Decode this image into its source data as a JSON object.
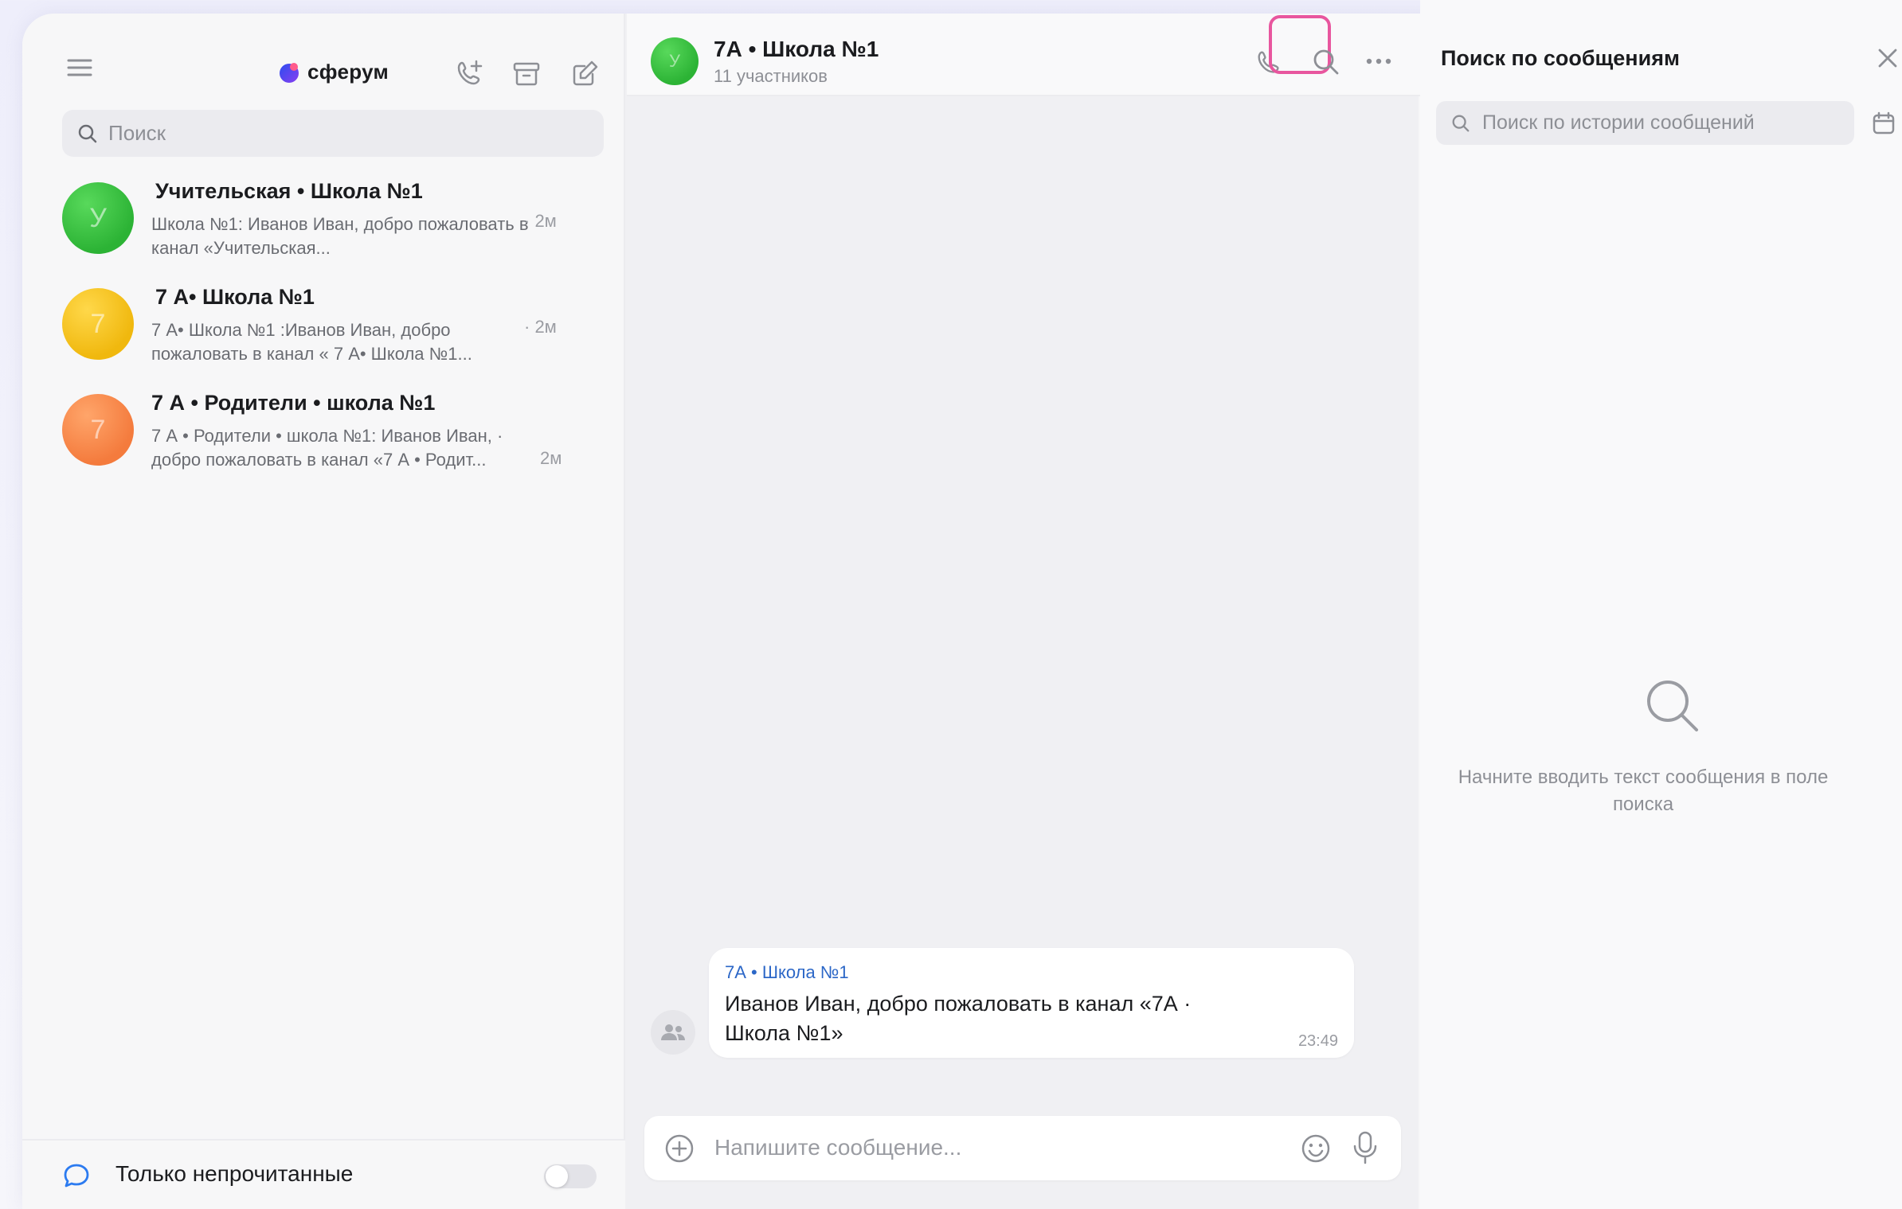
{
  "app": {
    "logo_text": "сферум",
    "brand_colors": {
      "logo_blue": "#2b4df0",
      "logo_purple": "#8a3ff0",
      "highlight": "#e8569e",
      "link": "#2c67c7"
    }
  },
  "sidebar": {
    "search_placeholder": "Поиск",
    "toolbar_icons": [
      "menu-icon",
      "call-add-icon",
      "archive-icon",
      "compose-icon"
    ],
    "chats": [
      {
        "title": "Учительская • Школа №1",
        "preview": "Школа №1: Иванов Иван, добро пожаловать в канал «Учительская...",
        "time": "· 2м",
        "avatar_letter": "У",
        "avatar_color": "#2cb335"
      },
      {
        "title": "7 А• Школа №1",
        "preview": "7 А• Школа №1 :Иванов Иван, добро пожаловать в канал « 7 А• Школа №1...",
        "time": "· 2м",
        "avatar_letter": "7",
        "avatar_color": "#f0b80e"
      },
      {
        "title": "7 А • Родители • школа №1",
        "preview": "7 А • Родители • школа №1: Иванов Иван, · добро пожаловать в канал «7 А • Родит...",
        "time": "2м",
        "avatar_letter": "7",
        "avatar_color": "#f47b3d"
      }
    ],
    "unread_only_label": "Только непрочитанные",
    "unread_only_enabled": false
  },
  "chat": {
    "title": "7А • Школа №1",
    "subtitle": "11 участников",
    "avatar_letter": "У",
    "message": {
      "from": "7А • Школа №1",
      "text": "Иванов Иван, добро пожаловать в канал «7А · Школа №1»",
      "time": "23:49"
    },
    "composer_placeholder": "Напишите сообщение..."
  },
  "search_panel": {
    "title": "Поиск по сообщениям",
    "placeholder": "Поиск по истории сообщений",
    "empty_text": "Начните вводить текст сообщения в поле поиска"
  }
}
